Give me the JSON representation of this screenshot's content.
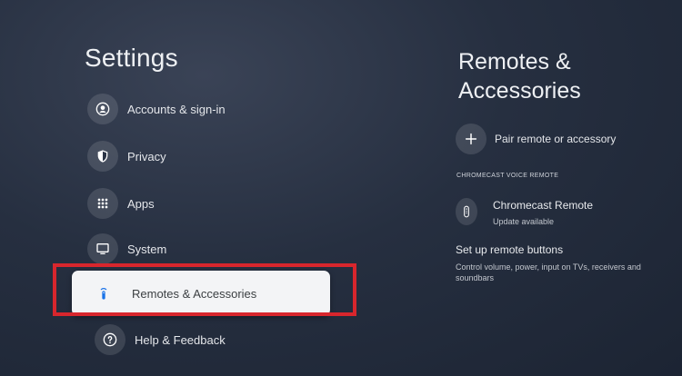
{
  "left_panel": {
    "title": "Settings",
    "items": [
      {
        "label": "Accounts & sign-in",
        "icon": "account-icon"
      },
      {
        "label": "Privacy",
        "icon": "shield-icon"
      },
      {
        "label": "Apps",
        "icon": "apps-grid-icon"
      },
      {
        "label": "System",
        "icon": "tv-icon"
      },
      {
        "label": "Remotes & Accessories",
        "icon": "remote-icon",
        "selected": true
      },
      {
        "label": "Help & Feedback",
        "icon": "help-icon"
      }
    ]
  },
  "right_panel": {
    "title": "Remotes & Accessories",
    "pair_label": "Pair remote or accessory",
    "section_caption": "CHROMECAST VOICE REMOTE",
    "remote_name": "Chromecast Remote",
    "remote_status": "Update available",
    "buttons_title": "Set up remote buttons",
    "buttons_description": "Control volume, power, input on TVs, receivers and soundbars"
  },
  "colors": {
    "highlight": "#d8262d",
    "selected_bg": "#f3f4f6",
    "selected_icon": "#1a73e8"
  }
}
